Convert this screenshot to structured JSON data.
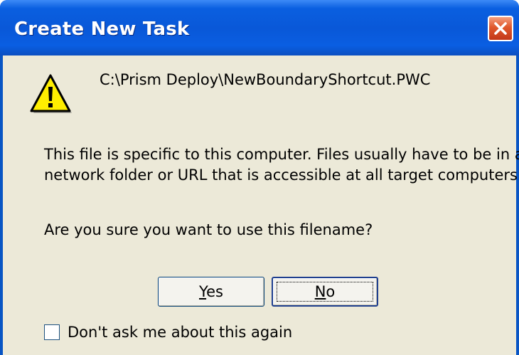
{
  "window": {
    "title": "Create New Task",
    "close_icon": "close-icon"
  },
  "icon": "warning-icon",
  "file_path": "C:\\Prism Deploy\\NewBoundaryShortcut.PWC",
  "message": {
    "line1": "This file is specific to this computer.  Files usually have to be in a",
    "line2": "network folder or URL that is accessible at all target computers."
  },
  "question": "Are you sure you want to use this filename?",
  "buttons": {
    "yes_mnemonic": "Y",
    "yes_rest": "es",
    "no_mnemonic": "N",
    "no_rest": "o"
  },
  "checkbox": {
    "label": "Don't ask me about this again",
    "checked": false
  },
  "colors": {
    "titlebar": "#0a5fe0",
    "client": "#ece9d8",
    "close_button": "#e0582b"
  }
}
